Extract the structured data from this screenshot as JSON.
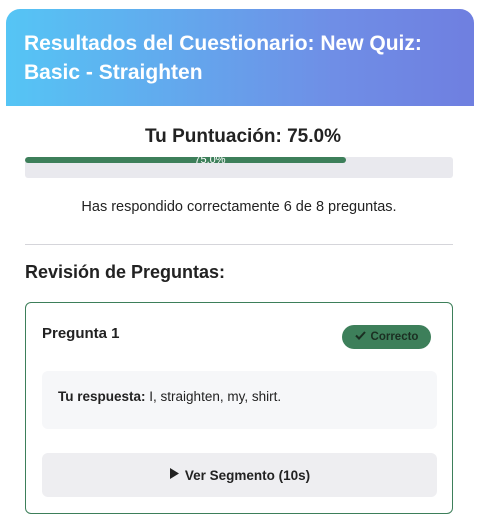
{
  "header": {
    "title": "Resultados del Cuestionario: New Quiz: Basic - Straighten"
  },
  "score": {
    "label": "Tu Puntuación: 75.0%",
    "bar_text": "75.0%",
    "percent": 75.0,
    "bar_color": "#3d7f5a"
  },
  "summary": {
    "text": "Has respondido correctamente 6 de 8 preguntas."
  },
  "review": {
    "title": "Revisión de Preguntas:",
    "questions": [
      {
        "title": "Pregunta 1",
        "status": "Correcto",
        "status_icon": "check-icon",
        "answer_label": "Tu respuesta:",
        "answer_value": "I, straighten, my, shirt.",
        "segment_button": "Ver Segmento (10s)",
        "segment_icon": "play-icon"
      }
    ]
  }
}
